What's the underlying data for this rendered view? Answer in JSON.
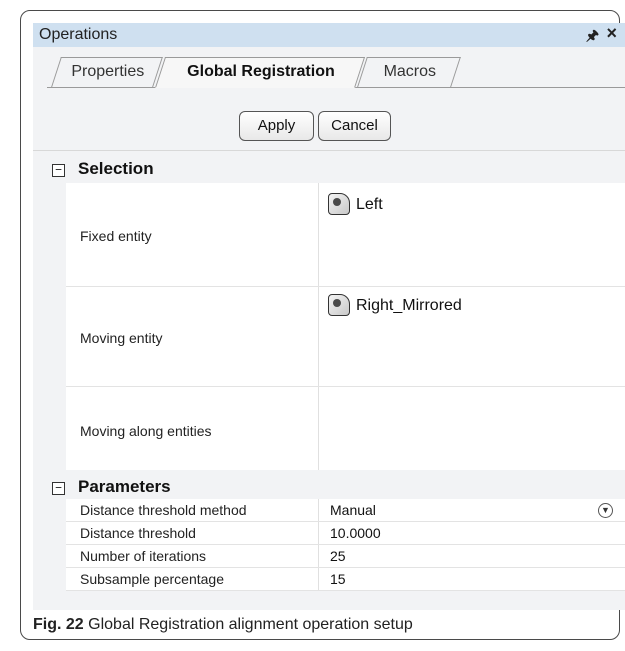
{
  "window": {
    "title": "Operations",
    "pin_glyph": "♅",
    "close_glyph": "×"
  },
  "tabs": [
    {
      "label": "Properties"
    },
    {
      "label": "Global Registration",
      "active": true
    },
    {
      "label": "Macros"
    }
  ],
  "buttons": {
    "apply": "Apply",
    "cancel": "Cancel"
  },
  "selection": {
    "header": "Selection",
    "toggle": "−",
    "rows": [
      {
        "label": "Fixed entity",
        "value": "Left",
        "icon": "mesh-entity-icon"
      },
      {
        "label": "Moving entity",
        "value": "Right_Mirrored",
        "icon": "mesh-entity-icon"
      },
      {
        "label": "Moving along entities",
        "value": ""
      }
    ]
  },
  "parameters": {
    "header": "Parameters",
    "toggle": "−",
    "rows": [
      {
        "label": "Distance threshold method",
        "value": "Manual",
        "has_dropdown": true
      },
      {
        "label": "Distance threshold",
        "value": "10.0000"
      },
      {
        "label": "Number of iterations",
        "value": "25"
      },
      {
        "label": "Subsample percentage",
        "value": "15"
      }
    ]
  },
  "caption": {
    "label": "Fig. 22",
    "text": "Global Registration alignment operation setup"
  }
}
